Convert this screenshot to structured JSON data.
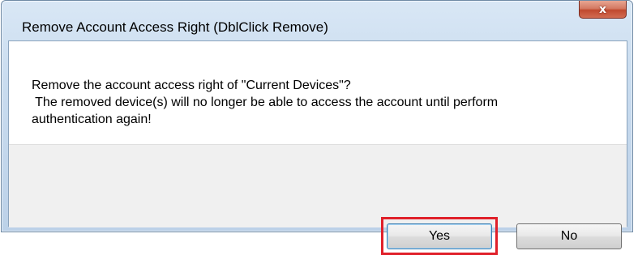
{
  "window": {
    "title": "Remove Account Access Right (DblClick Remove)",
    "close_glyph": "x"
  },
  "message": {
    "line1": "Remove the account access right of \"Current Devices\"?",
    "line2": " The removed device(s) will no longer be able to access the account until perform",
    "line3": "authentication again!"
  },
  "buttons": {
    "yes_label": "Yes",
    "no_label": "No"
  },
  "highlight": {
    "color": "#e0202a",
    "target": "yes-button"
  },
  "icons": {
    "close": "close-icon"
  }
}
